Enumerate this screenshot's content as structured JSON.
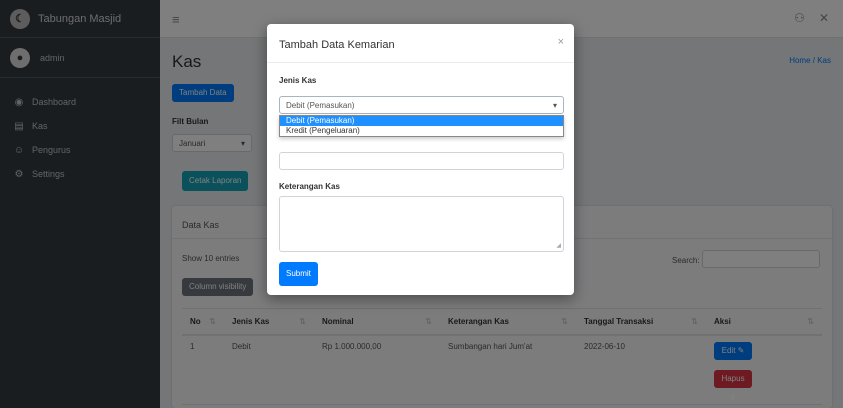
{
  "sidebar": {
    "brand": "Tabungan Masjid",
    "user": "admin",
    "items": [
      {
        "label": "Dashboard",
        "icon": "dashboard-icon",
        "glyph": "◉"
      },
      {
        "label": "Kas",
        "icon": "book-icon",
        "glyph": "▤"
      },
      {
        "label": "Pengurus",
        "icon": "users-icon",
        "glyph": "☺"
      },
      {
        "label": "Settings",
        "icon": "gear-icon",
        "glyph": "⚙"
      }
    ]
  },
  "topbar": {
    "menu_glyph": "≡",
    "user_glyph": "⚇",
    "close_glyph": "✕"
  },
  "page": {
    "title": "Kas",
    "breadcrumb": "Home / Kas",
    "add_button": "Tambah Data",
    "filter_label": "Filt Bulan",
    "filter_value": "Januari",
    "report_button": "Cetak Laporan"
  },
  "card": {
    "title": "Data Kas",
    "show_entries": "Show 10 entries",
    "search_label": "Search:",
    "export_button": "Column visibility",
    "table": {
      "columns": [
        "No",
        "Jenis Kas",
        "Nominal",
        "Keterangan Kas",
        "Tanggal Transaksi",
        "Aksi"
      ],
      "rows": [
        {
          "no": "1",
          "jenis": "Debit",
          "nominal": "Rp 1.000.000,00",
          "keterangan": "Sumbangan hari Jum'at",
          "tanggal": "2022-06-10"
        }
      ],
      "edit_label": "Edit",
      "delete_label": "Hapus"
    }
  },
  "modal": {
    "title": "Tambah Data Kemarian",
    "close_glyph": "×",
    "jenis_label": "Jenis Kas",
    "jenis_value": "Debit (Pemasukan)",
    "options": [
      "Debit (Pemasukan)",
      "Kredit (Pengeluaran)"
    ],
    "selected_index": 0,
    "keterangan_label": "Keterangan Kas",
    "submit": "Submit"
  }
}
